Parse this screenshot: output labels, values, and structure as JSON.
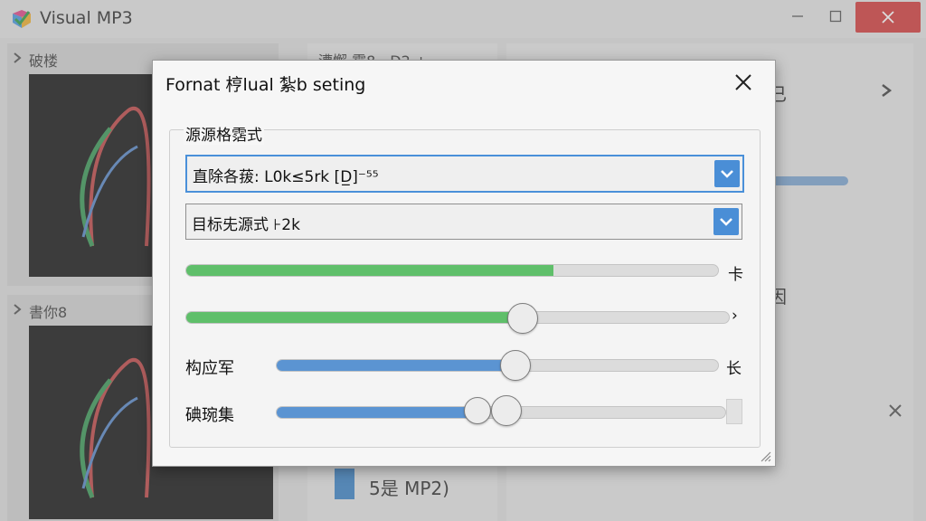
{
  "app": {
    "title": "Visual MP3",
    "panels": [
      {
        "label": "破楼"
      },
      {
        "label": "書你8"
      }
    ],
    "right": {
      "top_label": "漕懈 霉8一D2 ±",
      "fragment_1": "已",
      "fragment_2": "因",
      "file_label": "5是 MP2)"
    }
  },
  "dialog": {
    "title": "Fornat 梈lual 紮b seting",
    "group_label": "源源格霑式",
    "source_combo": "直除各菝:  L0k≤5rk  [D̲]⁻⁵⁵",
    "target_combo": "目标兂源式 ⊦2k",
    "sliders": [
      {
        "label": "",
        "end_label": "卡",
        "value_pct": 69,
        "fill": "green",
        "thumb": false
      },
      {
        "label": "",
        "end_label": "›",
        "value_pct": 62,
        "fill": "green",
        "thumb": true
      },
      {
        "label": "构应军",
        "end_label": "长",
        "value_pct": 52,
        "fill": "blue",
        "thumb": true
      },
      {
        "label": "碘琬集",
        "end_label": "",
        "value_pct": 45,
        "fill": "blue",
        "thumb": true,
        "double_thumb": true
      }
    ]
  },
  "colors": {
    "accent_blue": "#4a8ed6",
    "green": "#5fbf6a",
    "close_red": "#d44040"
  }
}
